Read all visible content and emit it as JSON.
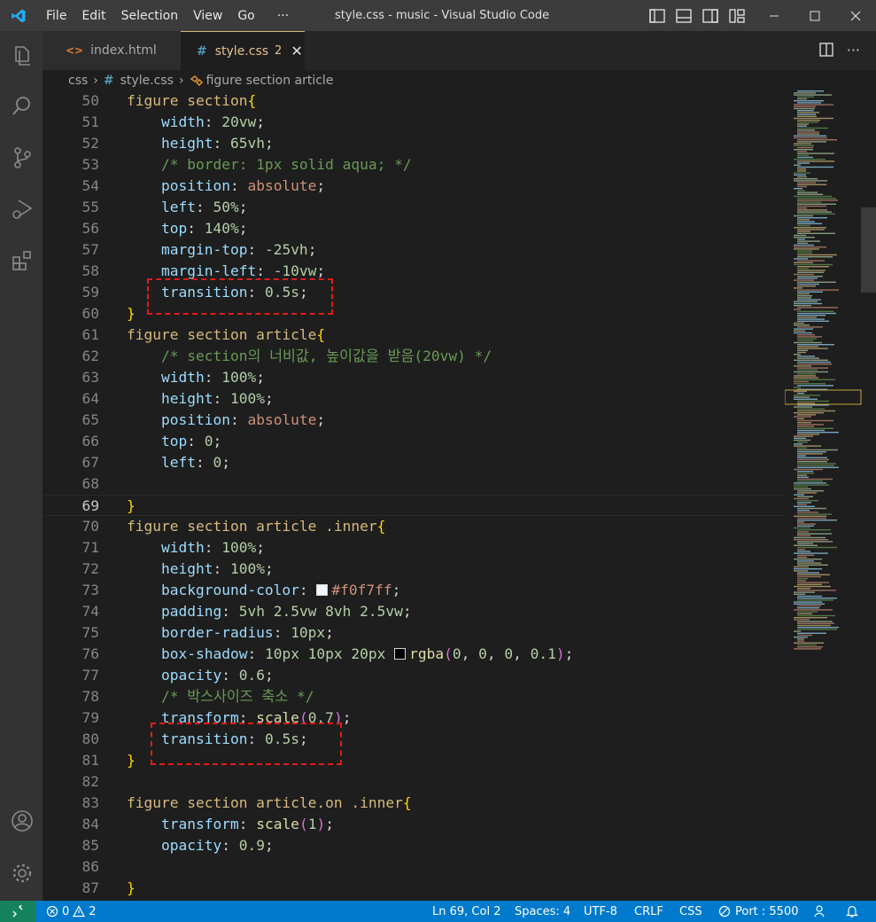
{
  "window": {
    "title": "style.css - music - Visual Studio Code",
    "menu": [
      "File",
      "Edit",
      "Selection",
      "View",
      "Go",
      "···"
    ]
  },
  "tabs": [
    {
      "label": "index.html",
      "icon": "html-file-icon",
      "icon_glyph": "<>",
      "active": false
    },
    {
      "label": "style.css",
      "icon": "css-file-icon",
      "icon_glyph": "#",
      "badge": "2",
      "active": true
    }
  ],
  "breadcrumb": {
    "folder": "css",
    "file": "style.css",
    "file_icon": "#",
    "symbol": "figure section article"
  },
  "editor": {
    "active_line": "69",
    "lines": [
      {
        "n": "50",
        "tokens": [
          [
            "sel",
            "figure section"
          ],
          [
            "brace",
            "{"
          ]
        ]
      },
      {
        "n": "51",
        "tokens": [
          [
            "plain",
            "    "
          ],
          [
            "prop",
            "width"
          ],
          [
            "plain",
            ": "
          ],
          [
            "num",
            "20vw"
          ],
          [
            "plain",
            ";"
          ]
        ]
      },
      {
        "n": "52",
        "tokens": [
          [
            "plain",
            "    "
          ],
          [
            "prop",
            "height"
          ],
          [
            "plain",
            ": "
          ],
          [
            "num",
            "65vh"
          ],
          [
            "plain",
            ";"
          ]
        ]
      },
      {
        "n": "53",
        "tokens": [
          [
            "plain",
            "    "
          ],
          [
            "cm",
            "/* border: 1px solid aqua; */"
          ]
        ]
      },
      {
        "n": "54",
        "tokens": [
          [
            "plain",
            "    "
          ],
          [
            "prop",
            "position"
          ],
          [
            "plain",
            ": "
          ],
          [
            "kw",
            "absolute"
          ],
          [
            "plain",
            ";"
          ]
        ]
      },
      {
        "n": "55",
        "tokens": [
          [
            "plain",
            "    "
          ],
          [
            "prop",
            "left"
          ],
          [
            "plain",
            ": "
          ],
          [
            "num",
            "50%"
          ],
          [
            "plain",
            ";"
          ]
        ]
      },
      {
        "n": "56",
        "tokens": [
          [
            "plain",
            "    "
          ],
          [
            "prop",
            "top"
          ],
          [
            "plain",
            ": "
          ],
          [
            "num",
            "140%"
          ],
          [
            "plain",
            ";"
          ]
        ]
      },
      {
        "n": "57",
        "tokens": [
          [
            "plain",
            "    "
          ],
          [
            "prop",
            "margin-top"
          ],
          [
            "plain",
            ": "
          ],
          [
            "num",
            "-25vh"
          ],
          [
            "plain",
            ";"
          ]
        ]
      },
      {
        "n": "58",
        "tokens": [
          [
            "plain",
            "    "
          ],
          [
            "prop",
            "margin-left"
          ],
          [
            "plain",
            ": "
          ],
          [
            "num",
            "-10vw"
          ],
          [
            "plain",
            ";"
          ]
        ]
      },
      {
        "n": "59",
        "tokens": [
          [
            "plain",
            "    "
          ],
          [
            "prop",
            "transition"
          ],
          [
            "plain",
            ": "
          ],
          [
            "num",
            "0.5s"
          ],
          [
            "plain",
            ";"
          ]
        ]
      },
      {
        "n": "60",
        "tokens": [
          [
            "brace",
            "}"
          ]
        ]
      },
      {
        "n": "61",
        "tokens": [
          [
            "sel",
            "figure section article"
          ],
          [
            "brace",
            "{"
          ]
        ]
      },
      {
        "n": "62",
        "tokens": [
          [
            "plain",
            "    "
          ],
          [
            "cm",
            "/* section의 너비값, 높이값을 받음(20vw) */"
          ]
        ]
      },
      {
        "n": "63",
        "tokens": [
          [
            "plain",
            "    "
          ],
          [
            "prop",
            "width"
          ],
          [
            "plain",
            ": "
          ],
          [
            "num",
            "100%"
          ],
          [
            "plain",
            ";"
          ]
        ]
      },
      {
        "n": "64",
        "tokens": [
          [
            "plain",
            "    "
          ],
          [
            "prop",
            "height"
          ],
          [
            "plain",
            ": "
          ],
          [
            "num",
            "100%"
          ],
          [
            "plain",
            ";"
          ]
        ]
      },
      {
        "n": "65",
        "tokens": [
          [
            "plain",
            "    "
          ],
          [
            "prop",
            "position"
          ],
          [
            "plain",
            ": "
          ],
          [
            "kw",
            "absolute"
          ],
          [
            "plain",
            ";"
          ]
        ]
      },
      {
        "n": "66",
        "tokens": [
          [
            "plain",
            "    "
          ],
          [
            "prop",
            "top"
          ],
          [
            "plain",
            ": "
          ],
          [
            "num",
            "0"
          ],
          [
            "plain",
            ";"
          ]
        ]
      },
      {
        "n": "67",
        "tokens": [
          [
            "plain",
            "    "
          ],
          [
            "prop",
            "left"
          ],
          [
            "plain",
            ": "
          ],
          [
            "num",
            "0"
          ],
          [
            "plain",
            ";"
          ]
        ]
      },
      {
        "n": "68",
        "tokens": []
      },
      {
        "n": "69",
        "tokens": [
          [
            "brace",
            "}"
          ]
        ]
      },
      {
        "n": "70",
        "tokens": [
          [
            "sel",
            "figure section article .inner"
          ],
          [
            "brace",
            "{"
          ]
        ]
      },
      {
        "n": "71",
        "tokens": [
          [
            "plain",
            "    "
          ],
          [
            "prop",
            "width"
          ],
          [
            "plain",
            ": "
          ],
          [
            "num",
            "100%"
          ],
          [
            "plain",
            ";"
          ]
        ]
      },
      {
        "n": "72",
        "tokens": [
          [
            "plain",
            "    "
          ],
          [
            "prop",
            "height"
          ],
          [
            "plain",
            ": "
          ],
          [
            "num",
            "100%"
          ],
          [
            "plain",
            ";"
          ]
        ]
      },
      {
        "n": "73",
        "tokens": [
          [
            "plain",
            "    "
          ],
          [
            "prop",
            "background-color"
          ],
          [
            "plain",
            ": "
          ],
          [
            "swatch",
            "#f0f7ff"
          ],
          [
            "kw",
            "#f0f7ff"
          ],
          [
            "plain",
            ";"
          ]
        ]
      },
      {
        "n": "74",
        "tokens": [
          [
            "plain",
            "    "
          ],
          [
            "prop",
            "padding"
          ],
          [
            "plain",
            ": "
          ],
          [
            "num",
            "5vh 2.5vw 8vh 2.5vw"
          ],
          [
            "plain",
            ";"
          ]
        ]
      },
      {
        "n": "75",
        "tokens": [
          [
            "plain",
            "    "
          ],
          [
            "prop",
            "border-radius"
          ],
          [
            "plain",
            ": "
          ],
          [
            "num",
            "10px"
          ],
          [
            "plain",
            ";"
          ]
        ]
      },
      {
        "n": "76",
        "tokens": [
          [
            "plain",
            "    "
          ],
          [
            "prop",
            "box-shadow"
          ],
          [
            "plain",
            ": "
          ],
          [
            "num",
            "10px 10px 20px "
          ],
          [
            "swatch",
            "#000000"
          ],
          [
            "fn",
            "rgba"
          ],
          [
            "paren",
            "("
          ],
          [
            "num",
            "0"
          ],
          [
            "plain",
            ", "
          ],
          [
            "num",
            "0"
          ],
          [
            "plain",
            ", "
          ],
          [
            "num",
            "0"
          ],
          [
            "plain",
            ", "
          ],
          [
            "num",
            "0.1"
          ],
          [
            "paren",
            ")"
          ],
          [
            "plain",
            ";"
          ]
        ]
      },
      {
        "n": "77",
        "tokens": [
          [
            "plain",
            "    "
          ],
          [
            "prop",
            "opacity"
          ],
          [
            "plain",
            ": "
          ],
          [
            "num",
            "0.6"
          ],
          [
            "plain",
            ";"
          ]
        ]
      },
      {
        "n": "78",
        "tokens": [
          [
            "plain",
            "    "
          ],
          [
            "cm",
            "/* 박스사이즈 축소 */"
          ]
        ]
      },
      {
        "n": "79",
        "tokens": [
          [
            "plain",
            "    "
          ],
          [
            "prop",
            "transform"
          ],
          [
            "plain",
            ": "
          ],
          [
            "fn",
            "scale"
          ],
          [
            "paren",
            "("
          ],
          [
            "num",
            "0.7"
          ],
          [
            "paren",
            ")"
          ],
          [
            "plain",
            ";"
          ]
        ]
      },
      {
        "n": "80",
        "tokens": [
          [
            "plain",
            "    "
          ],
          [
            "prop",
            "transition"
          ],
          [
            "plain",
            ": "
          ],
          [
            "num",
            "0.5s"
          ],
          [
            "plain",
            ";"
          ]
        ]
      },
      {
        "n": "81",
        "tokens": [
          [
            "brace",
            "}"
          ]
        ]
      },
      {
        "n": "82",
        "tokens": []
      },
      {
        "n": "83",
        "tokens": [
          [
            "sel",
            "figure section article.on .inner"
          ],
          [
            "brace",
            "{"
          ]
        ]
      },
      {
        "n": "84",
        "tokens": [
          [
            "plain",
            "    "
          ],
          [
            "prop",
            "transform"
          ],
          [
            "plain",
            ": "
          ],
          [
            "fn",
            "scale"
          ],
          [
            "paren",
            "("
          ],
          [
            "num",
            "1"
          ],
          [
            "paren",
            ")"
          ],
          [
            "plain",
            ";"
          ]
        ]
      },
      {
        "n": "85",
        "tokens": [
          [
            "plain",
            "    "
          ],
          [
            "prop",
            "opacity"
          ],
          [
            "plain",
            ": "
          ],
          [
            "num",
            "0.9"
          ],
          [
            "plain",
            ";"
          ]
        ]
      },
      {
        "n": "86",
        "tokens": []
      },
      {
        "n": "87",
        "tokens": [
          [
            "brace",
            "}"
          ]
        ]
      }
    ]
  },
  "statusbar": {
    "errors": "0",
    "warnings": "2",
    "position": "Ln 69, Col 2",
    "spaces": "Spaces: 4",
    "encoding": "UTF-8",
    "eol": "CRLF",
    "language": "CSS",
    "port": "Port : 5500"
  },
  "colors": {
    "accent": "#007acc",
    "remote": "#16825d",
    "annotation": "#e31b1b"
  }
}
